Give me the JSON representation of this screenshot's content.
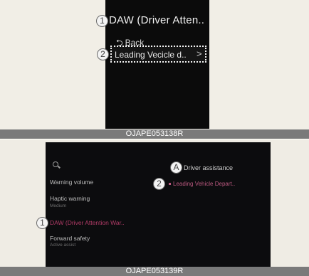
{
  "top_screen": {
    "callout_1": "1",
    "callout_2": "2",
    "title": "DAW (Driver Atten..",
    "back_label": "Back",
    "back_icon": "return-arrow-icon",
    "selected_item": "Leading Vecicle d..",
    "chevron": ">",
    "caption": "OJAPE053138R"
  },
  "bottom_screen": {
    "search_icon": "search-icon",
    "menu": [
      {
        "label": "Warning volume"
      },
      {
        "label": "Haptic warning",
        "sub": "Medium"
      },
      {
        "label": "DAW (Driver Attention War..",
        "highlight": true
      },
      {
        "label": "Forward safety",
        "sub": "Active assist"
      }
    ],
    "callout_1": "1",
    "callout_a": "A",
    "callout_2": "2",
    "right_header": "Driver assistance",
    "right_item": "Leading Vehicle Depart..",
    "caption": "OJAPE053139R"
  }
}
